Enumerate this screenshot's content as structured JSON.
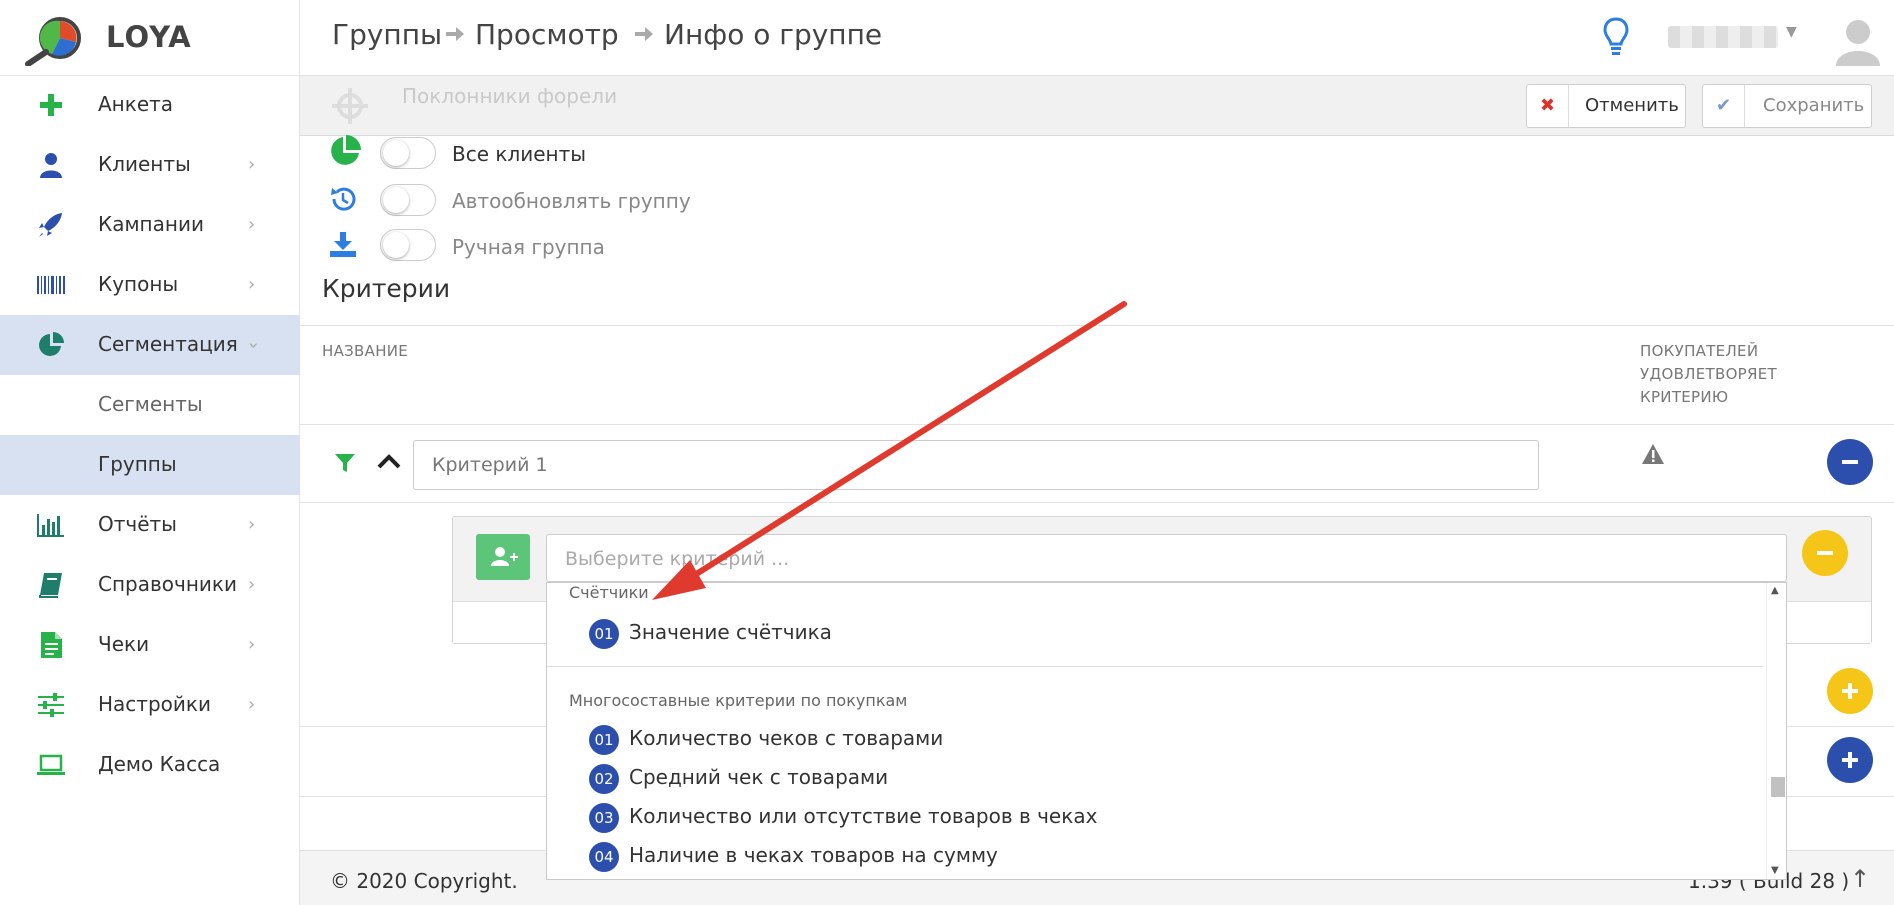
{
  "app": {
    "name": "LOYA"
  },
  "sidebar": {
    "items": [
      {
        "label": "Анкета",
        "icon": "plus-icon",
        "chevron": false
      },
      {
        "label": "Клиенты",
        "icon": "user-icon",
        "chevron": true
      },
      {
        "label": "Кампании",
        "icon": "rocket-icon",
        "chevron": true
      },
      {
        "label": "Купоны",
        "icon": "barcode-icon",
        "chevron": true
      },
      {
        "label": "Сегментация",
        "icon": "pie-chart-icon",
        "chevron": true,
        "expanded": true
      },
      {
        "label": "Сегменты",
        "sub": true
      },
      {
        "label": "Группы",
        "sub": true,
        "active": true
      },
      {
        "label": "Отчёты",
        "icon": "bar-chart-icon",
        "chevron": true
      },
      {
        "label": "Справочники",
        "icon": "book-icon",
        "chevron": true
      },
      {
        "label": "Чеки",
        "icon": "document-icon",
        "chevron": true
      },
      {
        "label": "Настройки",
        "icon": "sliders-icon",
        "chevron": true
      },
      {
        "label": "Демо Касса",
        "icon": "laptop-icon",
        "chevron": false
      }
    ]
  },
  "breadcrumb": [
    "Группы",
    "Просмотр",
    "Инфо о группе"
  ],
  "toolbar": {
    "group_name": "Поклонники форели",
    "cancel_label": "Отменить",
    "save_label": "Сохранить"
  },
  "toggles": [
    {
      "label": "Все клиенты",
      "on": false
    },
    {
      "label": "Автообновлять группу",
      "on": false
    },
    {
      "label": "Ручная группа",
      "on": false
    }
  ],
  "criteria": {
    "title": "Критерии",
    "col_name": "НАЗВАНИЕ",
    "col_buyers": [
      "ПОКУПАТЕЛЕЙ",
      "УДОВЛЕТВОРЯЕТ",
      "КРИТЕРИЮ"
    ],
    "criterion_value": "Критерий 1",
    "select_placeholder": "Выберите критерий ..."
  },
  "dropdown": {
    "groups": [
      {
        "title": "Счётчики",
        "options": [
          {
            "num": "01",
            "label": "Значение счётчика"
          }
        ]
      },
      {
        "title": "Многосоставные критерии по покупкам",
        "options": [
          {
            "num": "01",
            "label": "Количество чеков с товарами"
          },
          {
            "num": "02",
            "label": "Средний чек с товарами"
          },
          {
            "num": "03",
            "label": "Количество или отсутствие товаров в чеках"
          },
          {
            "num": "04",
            "label": "Наличие в чеках товаров на сумму"
          }
        ]
      }
    ]
  },
  "footer": {
    "copyright": "© 2020 Copyright.",
    "version": "1.39 ( Build 28 )"
  },
  "colors": {
    "accent": "#2c4fad",
    "green": "#27b24a",
    "yellow": "#f5c518",
    "active_bg": "#d7e1f2"
  }
}
